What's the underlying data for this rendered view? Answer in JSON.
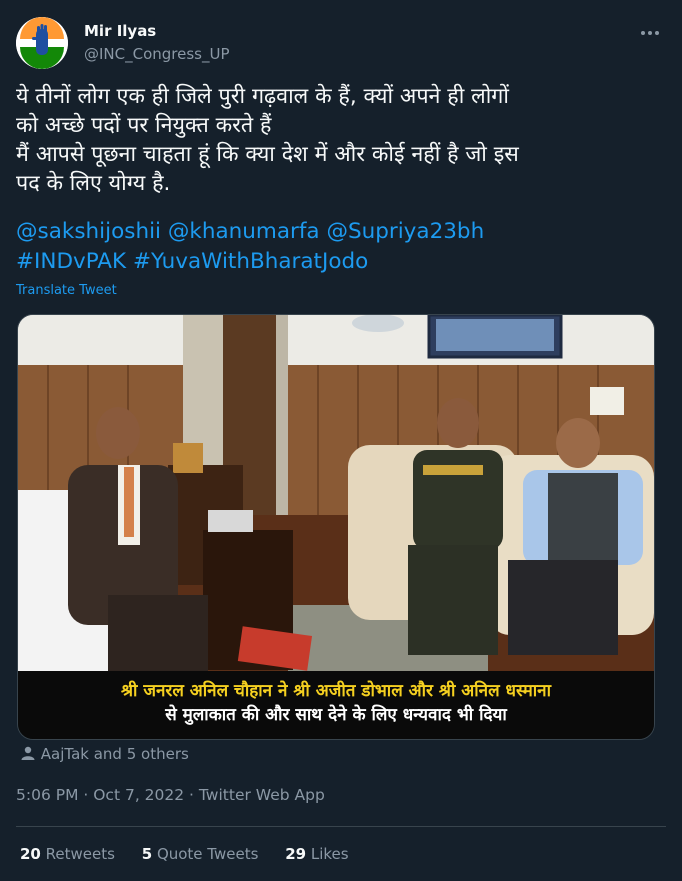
{
  "author": {
    "name": "Mir Ilyas",
    "handle": "@INC_Congress_UP"
  },
  "tweet": {
    "lines": [
      "ये तीनों लोग एक ही जिले पुरी गढ़वाल के हैं, क्यों अपने ही लोगों",
      "को अच्छे पदों पर नियुक्त करते हैं",
      "मैं आपसे पूछना चाहता हूं कि क्या देश में और कोई नहीं है जो इस",
      "पद के लिए योग्य है."
    ],
    "mentions": [
      "@sakshijoshii",
      "@khanumarfa",
      "@Supriya23bh"
    ],
    "hashtags": [
      "#INDvPAK",
      "#YuvaWithBharatJodo"
    ],
    "translate_label": "Translate Tweet"
  },
  "media": {
    "caption_line1": "श्री जनरल अनिल चौहान ने श्री अजीत डोभाल और श्री अनिल धस्माना",
    "caption_line2": "से मुलाकात की और साथ देने के लिए धन्यवाद भी दिया"
  },
  "tagged": "AajTak and 5 others",
  "timestamp": "5:06 PM · Oct 7, 2022 · Twitter Web App",
  "stats": {
    "retweets_count": "20",
    "retweets_label": "Retweets",
    "quotes_count": "5",
    "quotes_label": "Quote Tweets",
    "likes_count": "29",
    "likes_label": "Likes"
  },
  "colors": {
    "background": "#15202b",
    "link": "#1d9bf0",
    "muted": "#8b98a5",
    "caption_text": "#f5d020"
  },
  "icons": {
    "more": "more-icon",
    "tag": "person-tag-icon",
    "avatar": "congress-hand-logo"
  }
}
